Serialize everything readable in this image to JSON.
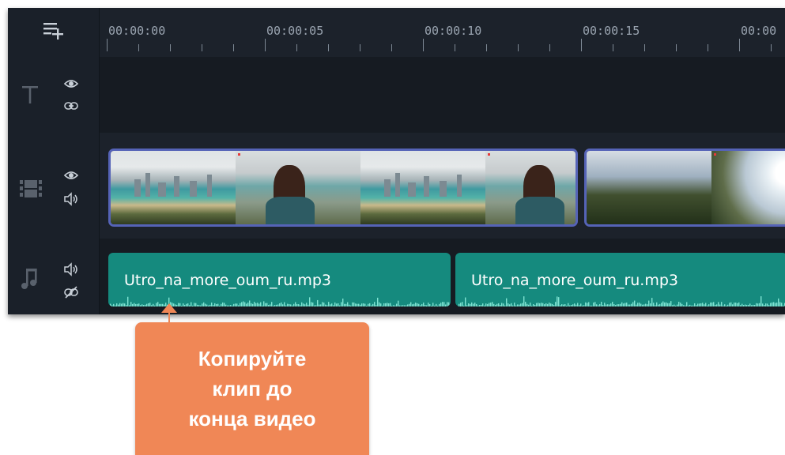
{
  "timeline": {
    "ruler_labels": [
      "00:00:00",
      "00:00:05",
      "00:00:10",
      "00:00:15",
      "00:00"
    ],
    "tracks": {
      "text": {
        "icons": [
          "text-icon",
          "eye-icon",
          "link-icon"
        ]
      },
      "video": {
        "icons": [
          "film-icon",
          "eye-icon",
          "speaker-icon"
        ]
      },
      "audio": {
        "icons": [
          "music-note-icon",
          "speaker-icon",
          "unlink-icon"
        ],
        "clips": [
          "Utro_na_more_oum_ru.mp3",
          "Utro_na_more_oum_ru.mp3"
        ]
      }
    }
  },
  "callout": {
    "text": "Копируйте\nклип до\nконца видео"
  },
  "colors": {
    "accent": "#f08756",
    "audio_clip": "#158a7e",
    "video_border": "#5563b7"
  }
}
